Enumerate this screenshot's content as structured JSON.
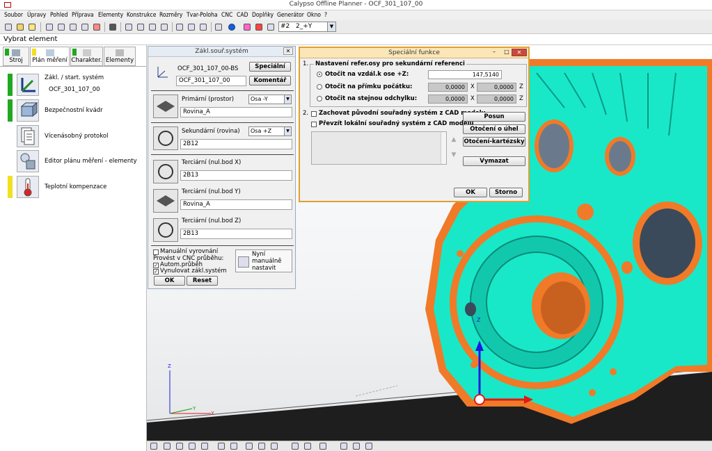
{
  "app": {
    "title": "Calypso Offline Planner - OCF_301_107_00"
  },
  "menu": [
    "Soubor",
    "Úpravy",
    "Pohled",
    "Příprava",
    "Elementy",
    "Konstrukce",
    "Rozměry",
    "Tvar-Poloha",
    "CNC",
    "CAD",
    "Doplňky",
    "Generátor",
    "Okno",
    "?"
  ],
  "toolbar": {
    "combo_num": "#2",
    "combo_val": "2_+Y"
  },
  "select_bar": "Vybrat element",
  "left_tabs": [
    "Stroj",
    "Plán měření",
    "Charakter.",
    "Elementy"
  ],
  "left_items": [
    {
      "line1": "Zákl. / start. systém",
      "line2": "OCF_301_107_00",
      "status": "#22a722"
    },
    {
      "line1": "Bezpečnostní kvádr",
      "line2": "",
      "status": "#22a722"
    },
    {
      "line1": "Vícenásobný protokol",
      "line2": "",
      "status": ""
    },
    {
      "line1": "Editor plánu měření - elementy",
      "line2": "",
      "status": ""
    },
    {
      "line1": "Teplotní kompenzace",
      "line2": "",
      "status": "#f0e020"
    }
  ],
  "dlg1": {
    "title": "Zákl.souř.systém",
    "name_label": "OCF_301_107_00-BS",
    "name_value": "OCF_301_107_00",
    "special_btn": "Speciální",
    "comment_btn": "Komentář",
    "primary_label": "Primární (prostor)",
    "primary_axis": "Osa -Y",
    "primary_value": "Rovina_A",
    "secondary_label": "Sekundární (rovina)",
    "secondary_axis": "Osa +Z",
    "secondary_value": "2B12",
    "tx_label": "Terciární (nul.bod X)",
    "tx_value": "2B13",
    "ty_label": "Terciární (nul.bod Y)",
    "ty_value": "Rovina_A",
    "tz_label": "Terciární (nul.bod Z)",
    "tz_value": "2B13",
    "manual_align": "Manuální vyrovnání",
    "cnc_run": "Provést v CNC průběhu:",
    "auto_run": "Autom.průběh",
    "reset_sys": "Vynulovat zákl.systém",
    "now_manual_1": "Nyní",
    "now_manual_2": "manuálně",
    "now_manual_3": "nastavit",
    "ok": "OK",
    "reset": "Reset"
  },
  "dlg2": {
    "title": "Speciální funkce",
    "sec1_num": "1.",
    "sec1_title": "Nastavení refer.osy pro sekundární referenci",
    "opt1": "Otočit na vzdál.k ose +Z:",
    "opt1_val": "147,5140",
    "opt2": "Otočit na přímku počátku:",
    "opt2_x": "0,0000",
    "opt2_z": "0,0000",
    "opt3": "Otočit na stejnou odchylku:",
    "opt3_x": "0,0000",
    "opt3_z": "0,0000",
    "x_lbl": "X",
    "z_lbl": "Z",
    "sec2_num": "2.",
    "keep_cad": "Zachovat původní souřadný systém z CAD modelu",
    "take_local": "Převzít lokální souřadný systém z CAD modelu",
    "btn_shift": "Posun",
    "btn_rot_angle": "Otočení o úhel",
    "btn_rot_cart": "Otočení-kartézsky",
    "btn_delete": "Vymazat",
    "ok": "OK",
    "cancel": "Storno"
  },
  "axes": {
    "z": "Z",
    "y": "Y",
    "x": "X"
  },
  "colors": {
    "part_fill": "#18e8c8",
    "part_edge": "#f07a28",
    "floor": "#1e1e1e",
    "axis_blue": "#1a1ae0",
    "axis_red": "#e01818"
  }
}
